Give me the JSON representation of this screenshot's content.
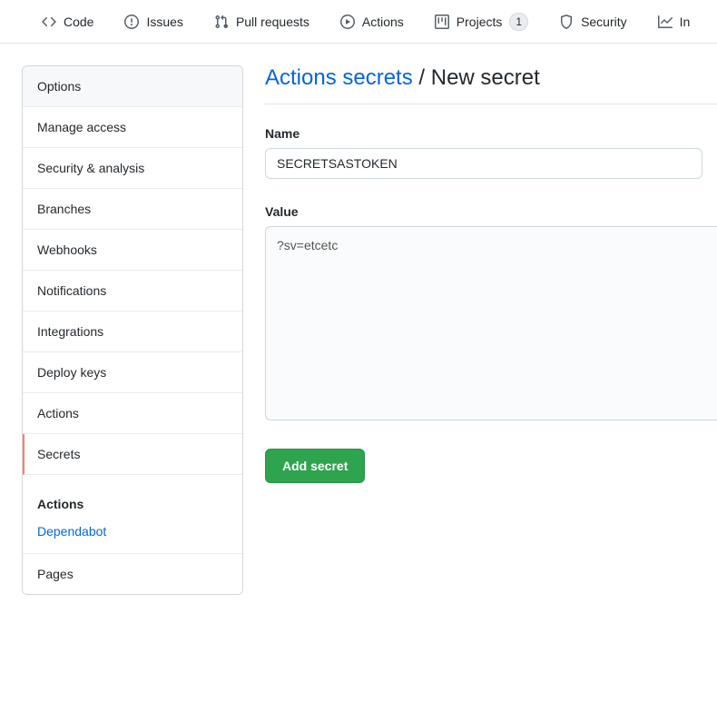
{
  "topnav": {
    "items": [
      {
        "label": "Code"
      },
      {
        "label": "Issues"
      },
      {
        "label": "Pull requests"
      },
      {
        "label": "Actions"
      },
      {
        "label": "Projects",
        "badge": "1"
      },
      {
        "label": "Security"
      },
      {
        "label": "In"
      }
    ]
  },
  "sidebar": {
    "items": [
      {
        "label": "Options"
      },
      {
        "label": "Manage access"
      },
      {
        "label": "Security & analysis"
      },
      {
        "label": "Branches"
      },
      {
        "label": "Webhooks"
      },
      {
        "label": "Notifications"
      },
      {
        "label": "Integrations"
      },
      {
        "label": "Deploy keys"
      },
      {
        "label": "Actions"
      },
      {
        "label": "Secrets"
      }
    ],
    "sub": {
      "header": "Actions",
      "link": "Dependabot"
    },
    "final": {
      "label": "Pages"
    }
  },
  "page": {
    "title_link": "Actions secrets",
    "title_sep": " / ",
    "title_current": "New secret"
  },
  "form": {
    "name_label": "Name",
    "name_value": "SECRETSASTOKEN",
    "value_label": "Value",
    "value_value": "?sv=etcetc",
    "submit_label": "Add secret"
  }
}
